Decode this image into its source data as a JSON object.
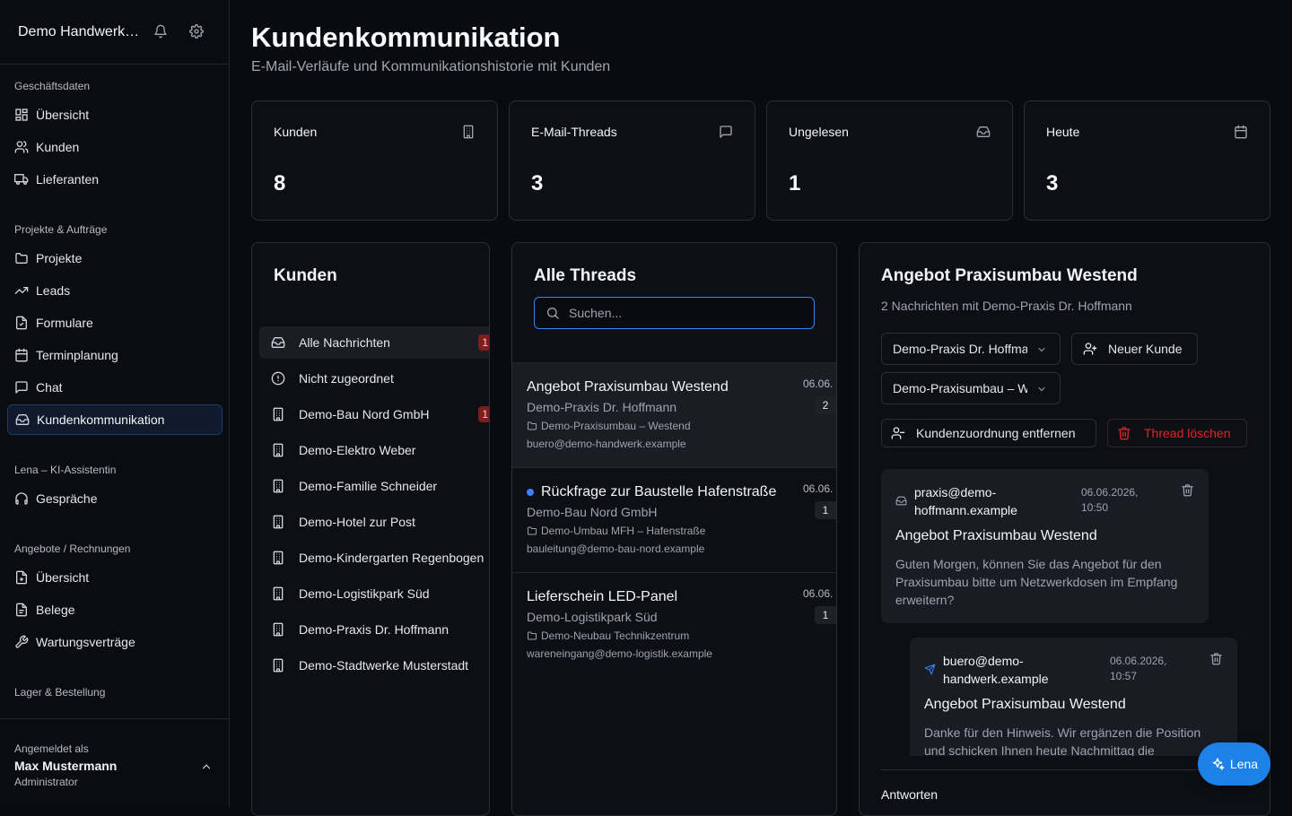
{
  "sidebar": {
    "org_name": "Demo Handwerksbetrieb",
    "sections": [
      {
        "label": "Geschäftsdaten"
      },
      {
        "label": "Projekte & Aufträge"
      },
      {
        "label": "Lena – KI-Assistentin"
      },
      {
        "label": "Angebote / Rechnungen"
      },
      {
        "label": "Lager & Bestellung"
      }
    ],
    "items": [
      {
        "label": "Übersicht",
        "icon": "dashboard-icon"
      },
      {
        "label": "Kunden",
        "icon": "users-icon"
      },
      {
        "label": "Lieferanten",
        "icon": "truck-icon"
      },
      {
        "label": "Projekte",
        "icon": "folder-icon"
      },
      {
        "label": "Leads",
        "icon": "trending-icon"
      },
      {
        "label": "Formulare",
        "icon": "form-icon"
      },
      {
        "label": "Terminplanung",
        "icon": "calendar-icon"
      },
      {
        "label": "Chat",
        "icon": "chat-icon"
      },
      {
        "label": "Kundenkommunikation",
        "icon": "inbox-icon",
        "active": true
      },
      {
        "label": "Gespräche",
        "icon": "headset-icon"
      },
      {
        "label": "Übersicht",
        "icon": "document-icon"
      },
      {
        "label": "Belege",
        "icon": "receipt-icon"
      },
      {
        "label": "Wartungsverträge",
        "icon": "wrench-icon"
      }
    ],
    "user": {
      "caption": "Angemeldet als",
      "name": "Max Mustermann",
      "role": "Administrator"
    }
  },
  "page": {
    "title": "Kundenkommunikation",
    "subtitle": "E-Mail-Verläufe und Kommunikationshistorie mit Kunden"
  },
  "stats": [
    {
      "label": "Kunden",
      "value": "8",
      "icon": "building-icon"
    },
    {
      "label": "E-Mail-Threads",
      "value": "3",
      "icon": "message-square-icon"
    },
    {
      "label": "Ungelesen",
      "value": "1",
      "icon": "inbox-icon"
    },
    {
      "label": "Heute",
      "value": "3",
      "icon": "calendar-icon"
    }
  ],
  "customers": {
    "title": "Kunden",
    "items": [
      {
        "label": "Alle Nachrichten",
        "badge": "1",
        "icon": "inbox-icon",
        "active": true
      },
      {
        "label": "Nicht zugeordnet",
        "icon": "alert-circle-icon"
      },
      {
        "label": "Demo-Bau Nord GmbH",
        "badge": "1",
        "icon": "building-icon"
      },
      {
        "label": "Demo-Elektro Weber",
        "icon": "building-icon"
      },
      {
        "label": "Demo-Familie Schneider",
        "icon": "building-icon"
      },
      {
        "label": "Demo-Hotel zur Post",
        "icon": "building-icon"
      },
      {
        "label": "Demo-Kindergarten Regenbogen",
        "icon": "building-icon"
      },
      {
        "label": "Demo-Logistikpark Süd",
        "icon": "building-icon"
      },
      {
        "label": "Demo-Praxis Dr. Hoffmann",
        "icon": "building-icon"
      },
      {
        "label": "Demo-Stadtwerke Musterstadt",
        "icon": "building-icon"
      }
    ]
  },
  "threads": {
    "title": "Alle Threads",
    "search_placeholder": "Suchen...",
    "items": [
      {
        "title": "Angebot Praxisumbau Westend",
        "customer": "Demo-Praxis Dr. Hoffmann",
        "project": "Demo-Praxisumbau – Westend",
        "email": "buero@demo-handwerk.example",
        "date": "06.06.",
        "count": "2",
        "unread": false,
        "active": true
      },
      {
        "title": "Rückfrage zur Baustelle Hafenstraße",
        "customer": "Demo-Bau Nord GmbH",
        "project": "Demo-Umbau MFH – Hafenstraße",
        "email": "bauleitung@demo-bau-nord.example",
        "date": "06.06.",
        "count": "1",
        "unread": true,
        "active": false
      },
      {
        "title": "Lieferschein LED-Panel",
        "customer": "Demo-Logistikpark Süd",
        "project": "Demo-Neubau Technikzentrum",
        "email": "wareneingang@demo-logistik.example",
        "date": "06.06.",
        "count": "1",
        "unread": false,
        "active": false
      }
    ]
  },
  "detail": {
    "title": "Angebot Praxisumbau Westend",
    "subtitle": "2 Nachrichten mit Demo-Praxis Dr. Hoffmann",
    "customer_select": "Demo-Praxis Dr. Hoffmann",
    "new_customer": "Neuer Kunde",
    "project_select": "Demo-Praxisumbau – Westend",
    "remove_assignment": "Kundenzuordnung entfernen",
    "delete_thread": "Thread löschen",
    "messages": [
      {
        "from": "praxis@demo-hoffmann.example",
        "date": "06.06.2026, 10:50",
        "subject": "Angebot Praxisumbau Westend",
        "body": "Guten Morgen, können Sie das Angebot für den Praxisumbau bitte um Netzwerkdosen im Empfang erweitern?",
        "direction": "incoming"
      },
      {
        "from": "buero@demo-handwerk.example",
        "date": "06.06.2026, 10:57",
        "subject": "Angebot Praxisumbau Westend",
        "body": "Danke für den Hinweis. Wir ergänzen die Position und schicken Ihnen heute Nachmittag die",
        "direction": "outgoing"
      }
    ],
    "reply_label": "Antworten"
  },
  "assistant": {
    "label": "Lena"
  }
}
